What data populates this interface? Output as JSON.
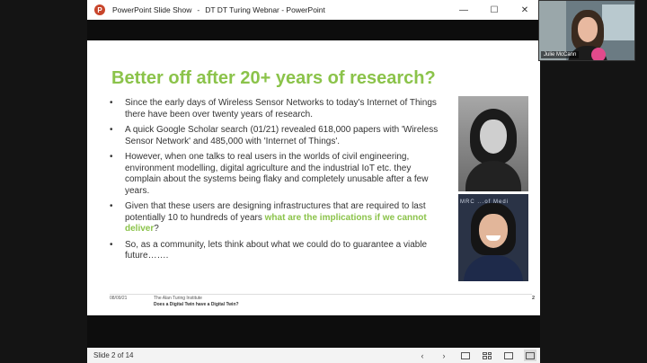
{
  "window": {
    "app_icon_letter": "P",
    "title_app": "PowerPoint Slide Show",
    "title_sep": "-",
    "title_doc": "DT DT Turing Webnar - PowerPoint",
    "minimize": "—",
    "maximize": "☐",
    "close": "✕"
  },
  "slide": {
    "title": "Better off after 20+ years of research?",
    "bullets": [
      "Since the early days of Wireless Sensor Networks to today's Internet of Things there have been over twenty years of research.",
      "A quick Google Scholar search (01/21) revealed 618,000 papers with 'Wireless Sensor Network' and 485,000 with 'Internet of Things'.",
      "However, when one talks to real users in the worlds of civil engineering, environment modelling, digital agriculture and the industrial IoT etc. they complain about the systems being flaky and completely unusable after a few years."
    ],
    "bullet4_pre": "Given that these users are designing infrastructures that are required to last potentially 10 to hundreds of years ",
    "bullet4_highlight": "what are the implications if we cannot deliver",
    "bullet4_post": "?",
    "bullet5": "So, as a community, lets think about what we could do to guarantee a viable future…….",
    "photo2_bg_text": "MRC     ...of Medi",
    "footer_date": "08/09/21",
    "footer_institute": "The Alan Turing Institute",
    "footer_subtitle": "Does a Digital Twin have a Digital Twin?",
    "page_number": "2"
  },
  "statusbar": {
    "slide_count": "Slide 2 of 14",
    "prev": "‹",
    "next": "›"
  },
  "webcam": {
    "name": "Julie McCann"
  },
  "colors": {
    "accent_green": "#8bc34a",
    "powerpoint_red": "#c8452b"
  }
}
